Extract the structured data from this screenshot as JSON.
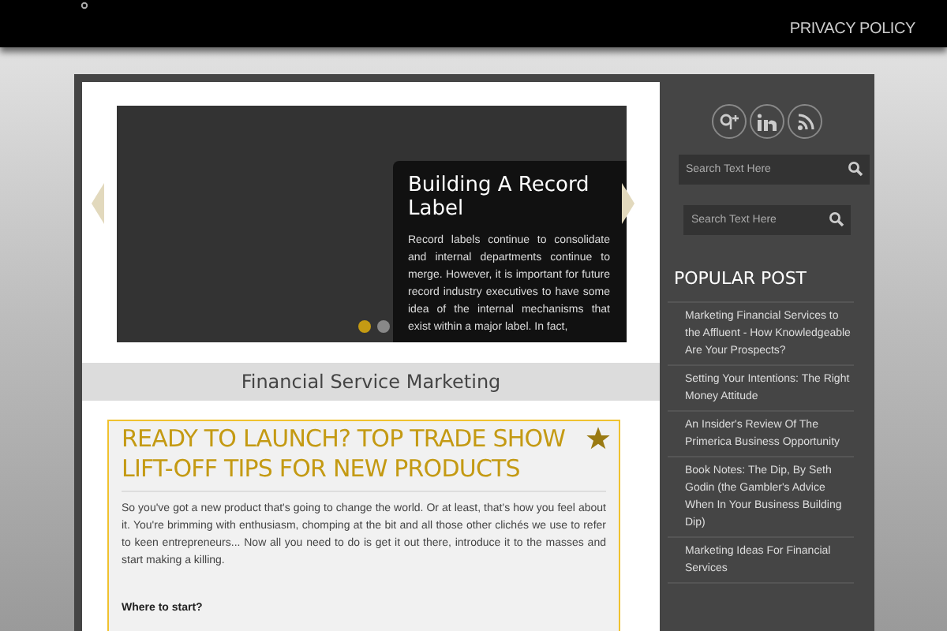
{
  "header": {
    "nav": [
      "PRIVACY POLICY"
    ]
  },
  "slider": {
    "title": "Building A Record Label",
    "text": "Record labels continue to consolidate and internal departments continue to merge. However, it is important for future record industry executives to have some idea of the internal mechanisms that exist within a major label. In fact,",
    "dots": [
      {
        "selected": true
      },
      {
        "selected": false
      }
    ]
  },
  "section_title": "Financial Service Marketing",
  "article": {
    "title": "READY TO LAUNCH? TOP TRADE SHOW LIFT-OFF TIPS FOR NEW PRODUCTS",
    "body": "So you've got a new product that's going to change the world. Or at least, that's how you feel about it. You're brimming with enthusiasm, chomping at the bit and all those other clichés we use to refer to keen entrepreneurs... Now all you need to do is get it out there, introduce it to the masses and start making a killing.",
    "subheading": "Where to start?"
  },
  "sidebar": {
    "searches": [
      {
        "placeholder": "Search Text Here"
      },
      {
        "placeholder": "Search Text Here"
      }
    ],
    "popular_title": "POPULAR POST",
    "popular_posts": [
      "Marketing Financial Services to the Affluent - How Knowledgeable Are Your Prospects?",
      "Setting Your Intentions: The Right Money Attitude",
      "An Insider's Review Of The Primerica Business Opportunity",
      "Book Notes: The Dip, By Seth Godin (the Gambler's Advice When In Your Business Building Dip)",
      "Marketing Ideas For Financial Services"
    ]
  }
}
